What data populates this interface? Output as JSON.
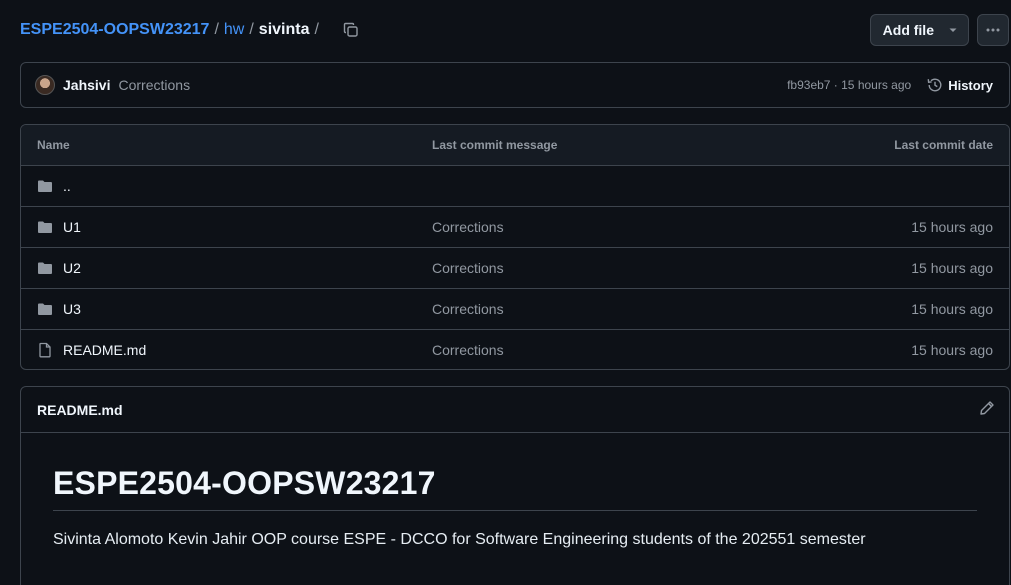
{
  "breadcrumb": {
    "repo": "ESPE2504-OOPSW23217",
    "folder": "hw",
    "current": "sivinta",
    "separator": "/"
  },
  "toolbar": {
    "add_file_label": "Add file",
    "add_file_icon": "triangle-down-icon",
    "more_icon": "kebab-horizontal-icon",
    "copy_icon": "copy-icon"
  },
  "latest_commit": {
    "author": "Jahsivi",
    "message": "Corrections",
    "meta": "fb93eb7 · 15 hours ago",
    "history_label": "History"
  },
  "file_table": {
    "headers": {
      "name": "Name",
      "message": "Last commit message",
      "date": "Last commit date"
    },
    "rows": [
      {
        "name": "..",
        "type": "folder",
        "message": "",
        "date": ""
      },
      {
        "name": "U1",
        "type": "folder",
        "message": "Corrections",
        "date": "15 hours ago"
      },
      {
        "name": "U2",
        "type": "folder",
        "message": "Corrections",
        "date": "15 hours ago"
      },
      {
        "name": "U3",
        "type": "folder",
        "message": "Corrections",
        "date": "15 hours ago"
      },
      {
        "name": "README.md",
        "type": "file",
        "message": "Corrections",
        "date": "15 hours ago"
      }
    ]
  },
  "readme": {
    "filename": "README.md",
    "title": "ESPE2504-OOPSW23217",
    "text": "Sivinta Alomoto Kevin Jahir OOP course ESPE - DCCO for Software Engineering students of the 202551 semester"
  },
  "colors": {
    "background": "#0d1117",
    "border": "#3d444d",
    "link": "#4493f8",
    "muted": "#9198a1",
    "text": "#f0f6fc"
  }
}
